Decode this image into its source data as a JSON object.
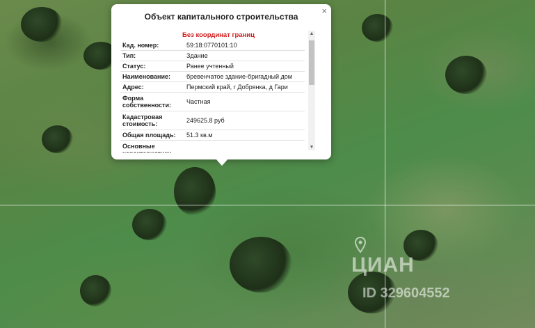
{
  "popup": {
    "title": "Объект капитального строительства",
    "close": "×",
    "status": "Без координат границ",
    "rows": [
      {
        "key": "Кад. номер:",
        "value": "59:18:0770101:10"
      },
      {
        "key": "Тип:",
        "value": "Здание"
      },
      {
        "key": "Статус:",
        "value": "Ранее учтенный"
      },
      {
        "key": "Наименование:",
        "value": "бревенчатое здание-бригадный дом"
      },
      {
        "key": "Адрес:",
        "value": "Пермский край, г Добрянка, д Гари"
      },
      {
        "key": "Форма собственности:",
        "value": "Частная"
      },
      {
        "key": "Кадастровая стоимость:",
        "value": "249625.8 руб"
      },
      {
        "key": "Общая площадь:",
        "value": "51.3 кв.м"
      },
      {
        "key": "Основные характеристики",
        "value": ""
      }
    ],
    "scroll_up": "▲",
    "scroll_down": "▼"
  },
  "watermark": {
    "logo": "ЦИАН",
    "id": "ID 329604552"
  },
  "icons": {
    "close": "close-icon",
    "pin": "map-pin-icon"
  }
}
